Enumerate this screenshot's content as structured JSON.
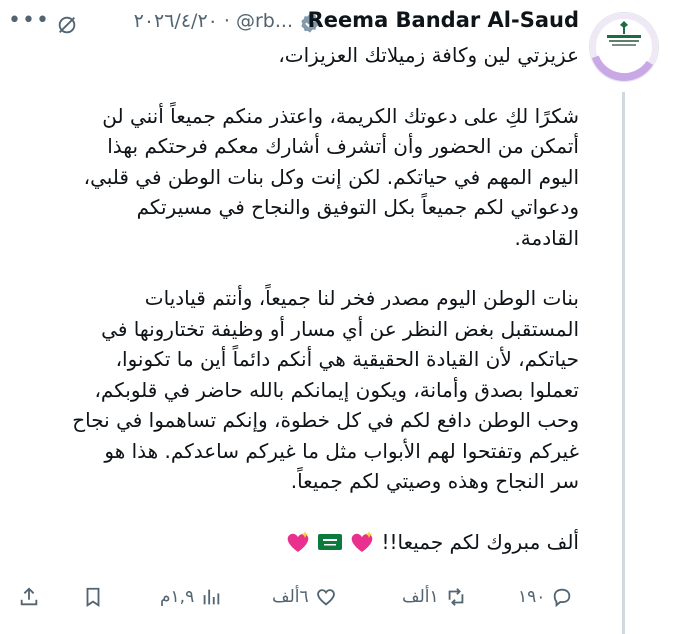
{
  "author": {
    "name": "Reema Bandar Al-Saud",
    "handle": "@rb...",
    "separator": "·",
    "date": "٢٠٢٦/٤/٢٠"
  },
  "tweet": {
    "greeting": "عزيزتي لين وكافة زميلاتك العزيزات،",
    "paragraph1": [
      "شكرًا لكِ على دعوتك الكريمة، واعتذر منكم جميعاً أنني لن",
      "أتمكن من الحضور وأن أتشرف أشارك معكم فرحتكم بهذا",
      "اليوم المهم في حياتكم. لكن إنت وكل بنات الوطن في قلبي،",
      "ودعواتي لكم جميعاً بكل التوفيق والنجاح في مسيرتكم",
      "القادمة."
    ],
    "paragraph2": [
      "بنات الوطن اليوم مصدر فخر لنا جميعاً، وأنتم قياديات",
      "المستقبل بغض النظر عن أي مسار أو وظيفة تختارونها في",
      "حياتكم، لأن القيادة الحقيقية هي أنكم دائماً أين ما تكونوا،",
      "تعملوا بصدق وأمانة، ويكون إيمانكم بالله حاضر في قلوبكم،",
      "وحب الوطن دافع لكم في كل خطوة، وإنكم تساهموا في نجاح",
      "غيركم وتفتحوا لهم الأبواب مثل ما غيركم ساعدكم. هذا هو",
      "سر النجاح وهذه وصيتي لكم جميعاً."
    ],
    "closing": "ألف مبروك لكم جميعا!!",
    "emojis": [
      "sparkling-heart",
      "saudi-flag",
      "sparkling-heart"
    ]
  },
  "actions": {
    "replies": "١٩٠",
    "reposts": "١ألف",
    "likes": "٦ألف",
    "views": "١,٩م"
  },
  "colors": {
    "text": "#0f1419",
    "secondary": "#536471",
    "verified": "#829aab",
    "heart": "#e8308c",
    "flag": "#0a7a3d"
  }
}
